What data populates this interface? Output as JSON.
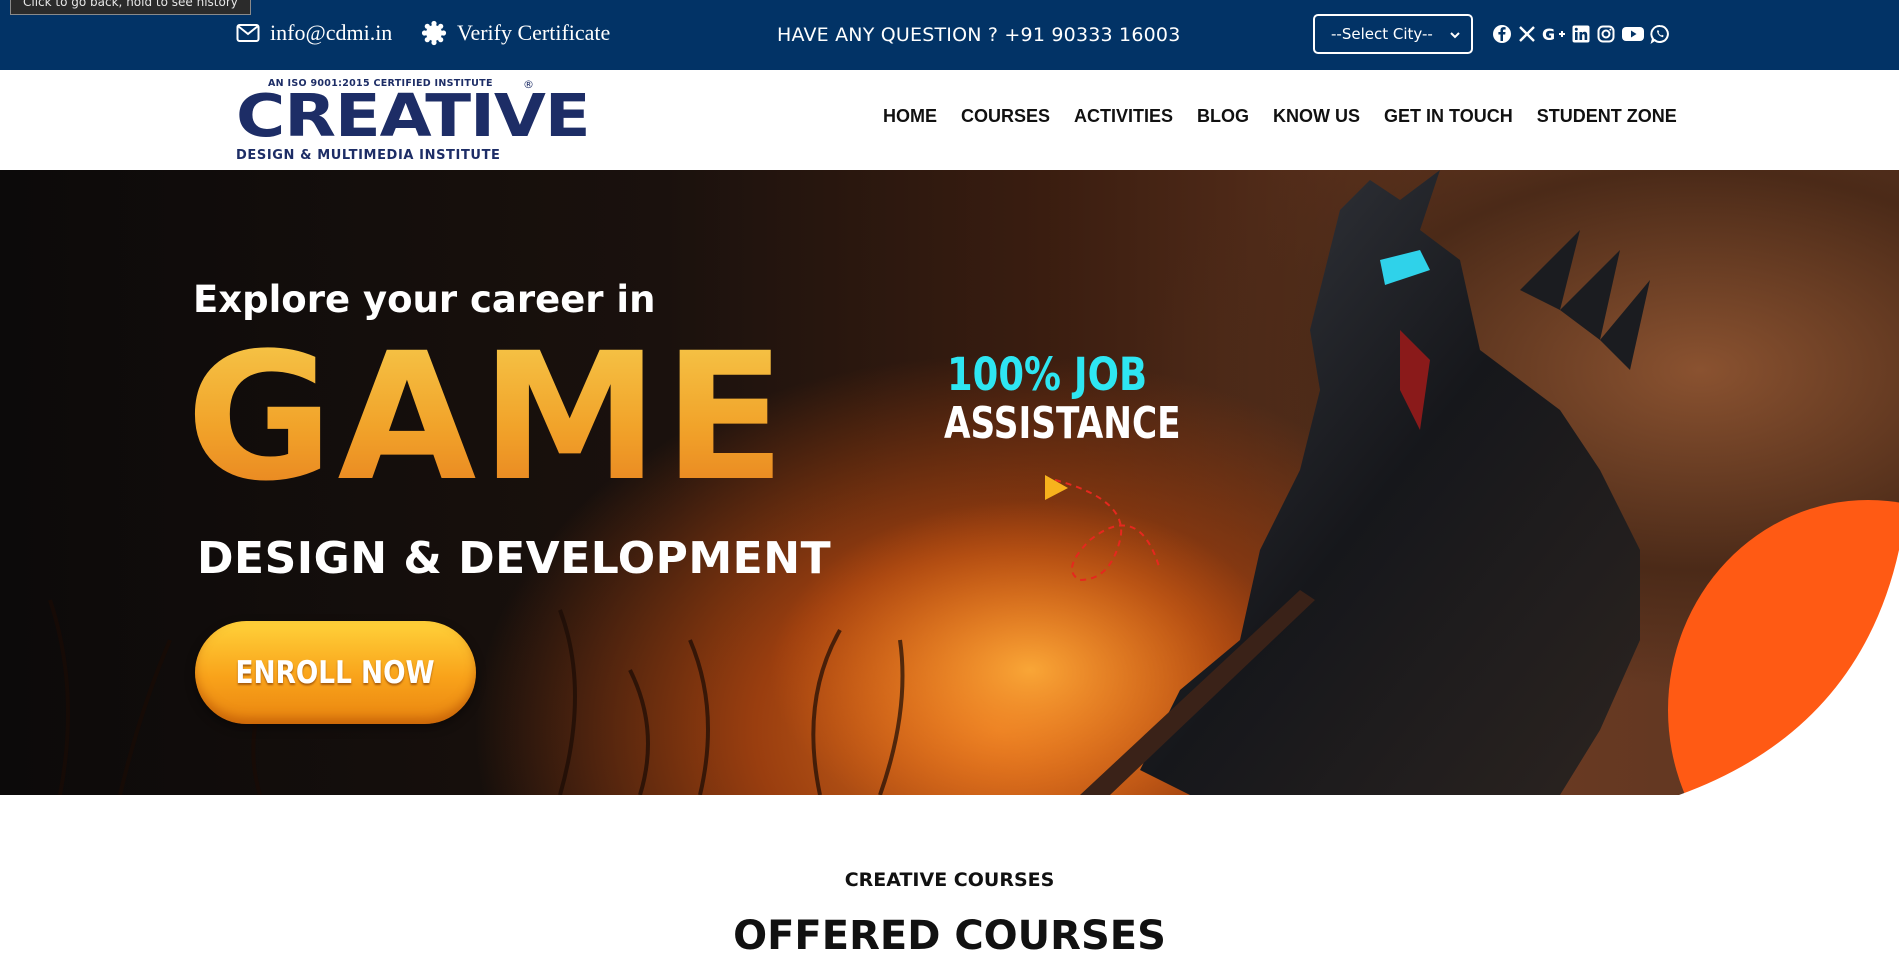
{
  "browser_tooltip": "Click to go back, hold to see history",
  "topbar": {
    "email": "info@cdmi.in",
    "verify": "Verify Certificate",
    "question": "HAVE ANY QUESTION ? +91 90333 16003",
    "city_select": "--Select City--",
    "socials": [
      "facebook-icon",
      "x-twitter-icon",
      "google-plus-icon",
      "linkedin-icon",
      "instagram-icon",
      "youtube-icon",
      "whatsapp-icon"
    ],
    "bg_color": "#023366"
  },
  "logo": {
    "iso": "AN ISO 9001:2015 CERTIFIED INSTITUTE",
    "reg": "®",
    "main": "CREATIVE",
    "sub": "DESIGN & MULTIMEDIA INSTITUTE",
    "color": "#1d2d66"
  },
  "nav": [
    "HOME",
    "COURSES",
    "ACTIVITIES",
    "BLOG",
    "KNOW US",
    "GET IN TOUCH",
    "STUDENT ZONE"
  ],
  "hero": {
    "eyebrow": "Explore your career in",
    "headline": "GAME",
    "subhead": "DESIGN & DEVELOPMENT",
    "cta": "ENROLL NOW",
    "job_line1": "100% JOB",
    "job_line2": "ASSISTANCE",
    "accent": "#ff5a14"
  },
  "section": {
    "kicker": "CREATIVE COURSES",
    "title": "OFFERED COURSES"
  }
}
